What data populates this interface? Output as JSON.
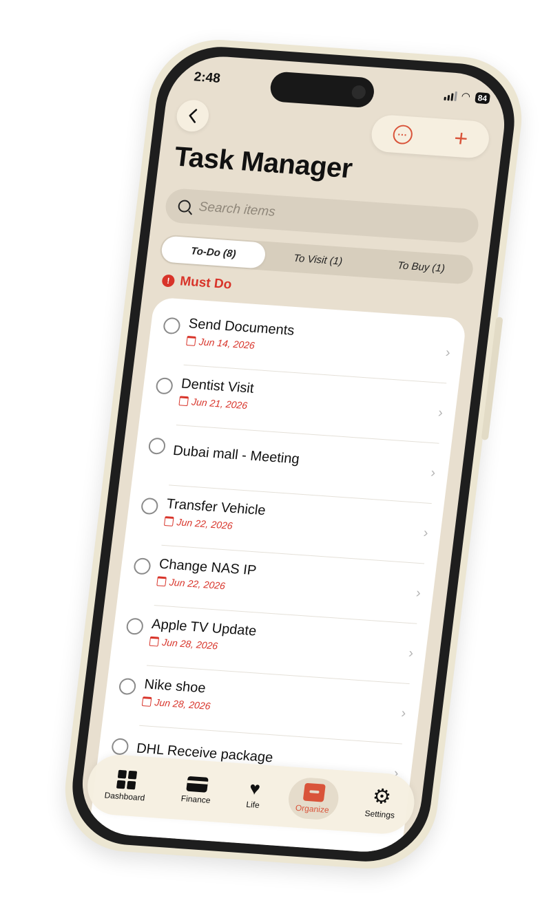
{
  "status": {
    "time": "2:48",
    "battery": "84"
  },
  "header": {
    "title": "Task Manager"
  },
  "search": {
    "placeholder": "Search items"
  },
  "tabs": [
    {
      "label": "To-Do (8)",
      "active": true
    },
    {
      "label": "To Visit (1)",
      "active": false
    },
    {
      "label": "To Buy (1)",
      "active": false
    }
  ],
  "section": {
    "label": "Must Do",
    "color": "#d8342a"
  },
  "tasks": [
    {
      "title": "Send Documents",
      "date": "Jun 14, 2026"
    },
    {
      "title": "Dentist Visit",
      "date": "Jun 21, 2026"
    },
    {
      "title": "Dubai mall - Meeting",
      "date": ""
    },
    {
      "title": "Transfer Vehicle",
      "date": "Jun 22, 2026"
    },
    {
      "title": "Change NAS IP",
      "date": "Jun 22, 2026"
    },
    {
      "title": "Apple TV Update",
      "date": "Jun 28, 2026"
    },
    {
      "title": "Nike shoe",
      "date": "Jun 28, 2026"
    },
    {
      "title": "DHL Receive package",
      "date": ""
    }
  ],
  "tabbar": [
    {
      "label": "Dashboard",
      "icon": "dashboard-icon",
      "active": false
    },
    {
      "label": "Finance",
      "icon": "card-icon",
      "active": false
    },
    {
      "label": "Life",
      "icon": "heart-icon",
      "active": false
    },
    {
      "label": "Organize",
      "icon": "toolbox-icon",
      "active": true
    },
    {
      "label": "Settings",
      "icon": "gear-icon",
      "active": false
    }
  ],
  "colors": {
    "accent": "#d9543a",
    "background": "#e8dfcf",
    "card": "#ffffff"
  }
}
